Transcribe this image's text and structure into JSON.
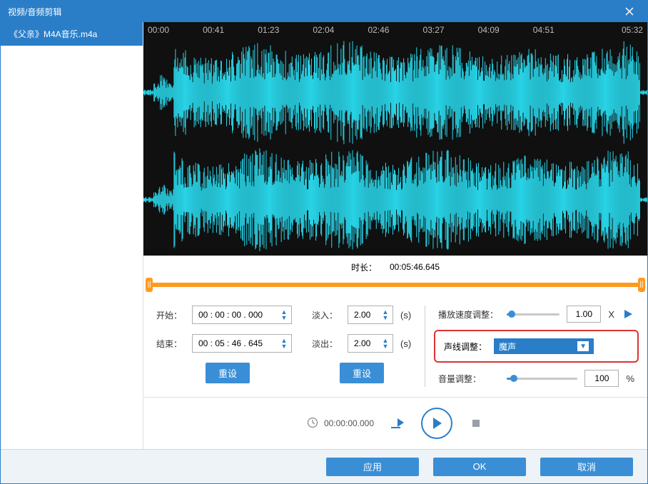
{
  "window": {
    "title": "视频/音频剪辑"
  },
  "sidebar": {
    "items": [
      {
        "label": "《父亲》M4A音乐.m4a"
      }
    ]
  },
  "timeline": {
    "ticks": [
      "00:00",
      "00:41",
      "01:23",
      "02:04",
      "02:46",
      "03:27",
      "04:09",
      "04:51",
      "05:32"
    ]
  },
  "duration": {
    "label": "时长：",
    "value": "00:05:46.645"
  },
  "col1": {
    "start_label": "开始：",
    "start_value": "00 : 00 : 00 . 000",
    "end_label": "结束：",
    "end_value": "00 : 05 : 46 . 645",
    "reset": "重设"
  },
  "col2": {
    "fadein_label": "淡入：",
    "fadein_value": "2.00",
    "fadein_unit": "(s)",
    "fadeout_label": "淡出：",
    "fadeout_value": "2.00",
    "fadeout_unit": "(s)",
    "reset": "重设"
  },
  "col3": {
    "speed_label": "播放速度调整：",
    "speed_value": "1.00",
    "speed_unit": "X",
    "speed_pct": 10,
    "voice_label": "声线调整：",
    "voice_selected": "魔声",
    "volume_label": "音量调整：",
    "volume_value": "100",
    "volume_unit": "%",
    "volume_pct": 10
  },
  "playback": {
    "time": "00:00:00.000"
  },
  "footer": {
    "apply": "应用",
    "ok": "OK",
    "cancel": "取消"
  }
}
